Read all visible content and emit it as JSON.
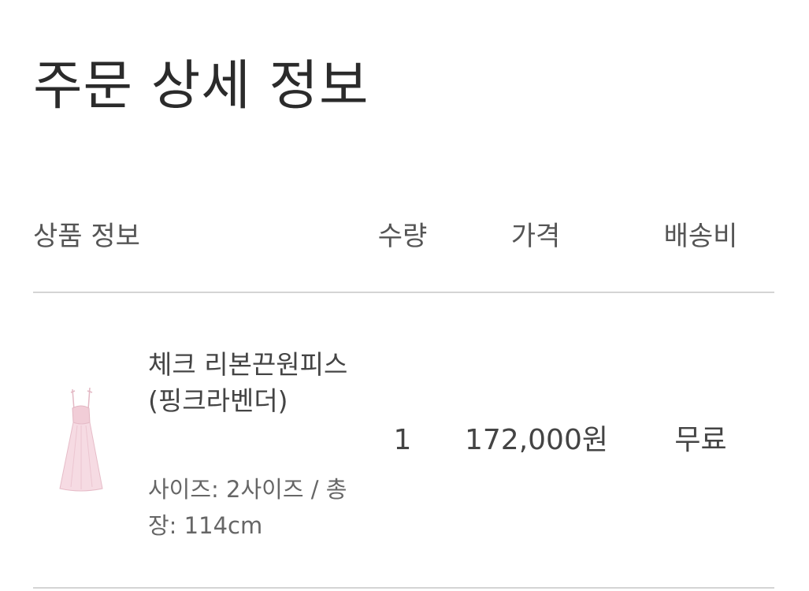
{
  "page": {
    "title": "주문 상세 정보"
  },
  "table": {
    "headers": {
      "product_info": "상품 정보",
      "quantity": "수량",
      "price": "가격",
      "shipping": "배송비"
    },
    "rows": [
      {
        "name": "체크 리본끈원피스 (핑크라벤더)",
        "option": "사이즈: 2사이즈 / 총장: 114cm",
        "quantity": "1",
        "price": "172,000원",
        "shipping": "무료",
        "thumbnail_icon": "pink-dress-image",
        "thumbnail_color": "#f4d7df"
      }
    ]
  }
}
